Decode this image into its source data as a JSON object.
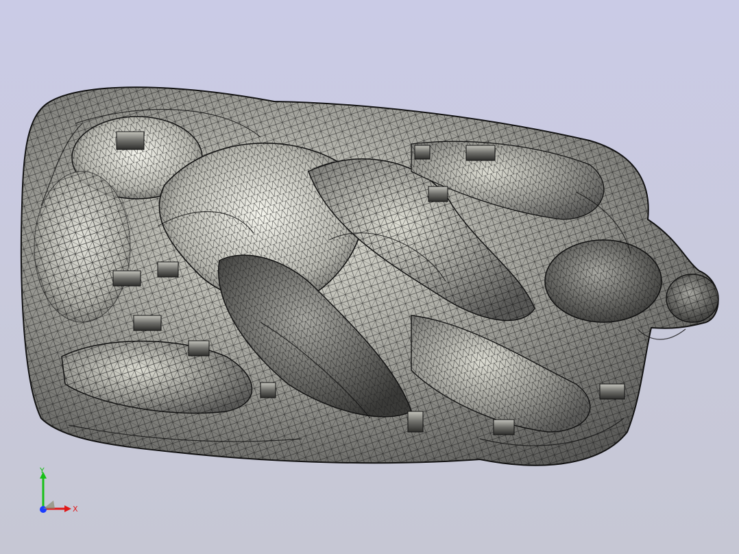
{
  "viewport": {
    "background_top": "#cacbe6",
    "background_bottom": "#c6c7d4"
  },
  "model": {
    "display_mode": "shaded-with-mesh-edges",
    "surface_color": "#8e8e8a",
    "highlight_color": "#f2f2ea",
    "edge_color": "#1a1a1a"
  },
  "triad": {
    "x_label": "X",
    "y_label": "Y",
    "x_color": "#e01818",
    "y_color": "#18c018",
    "z_color": "#1a3cff"
  }
}
